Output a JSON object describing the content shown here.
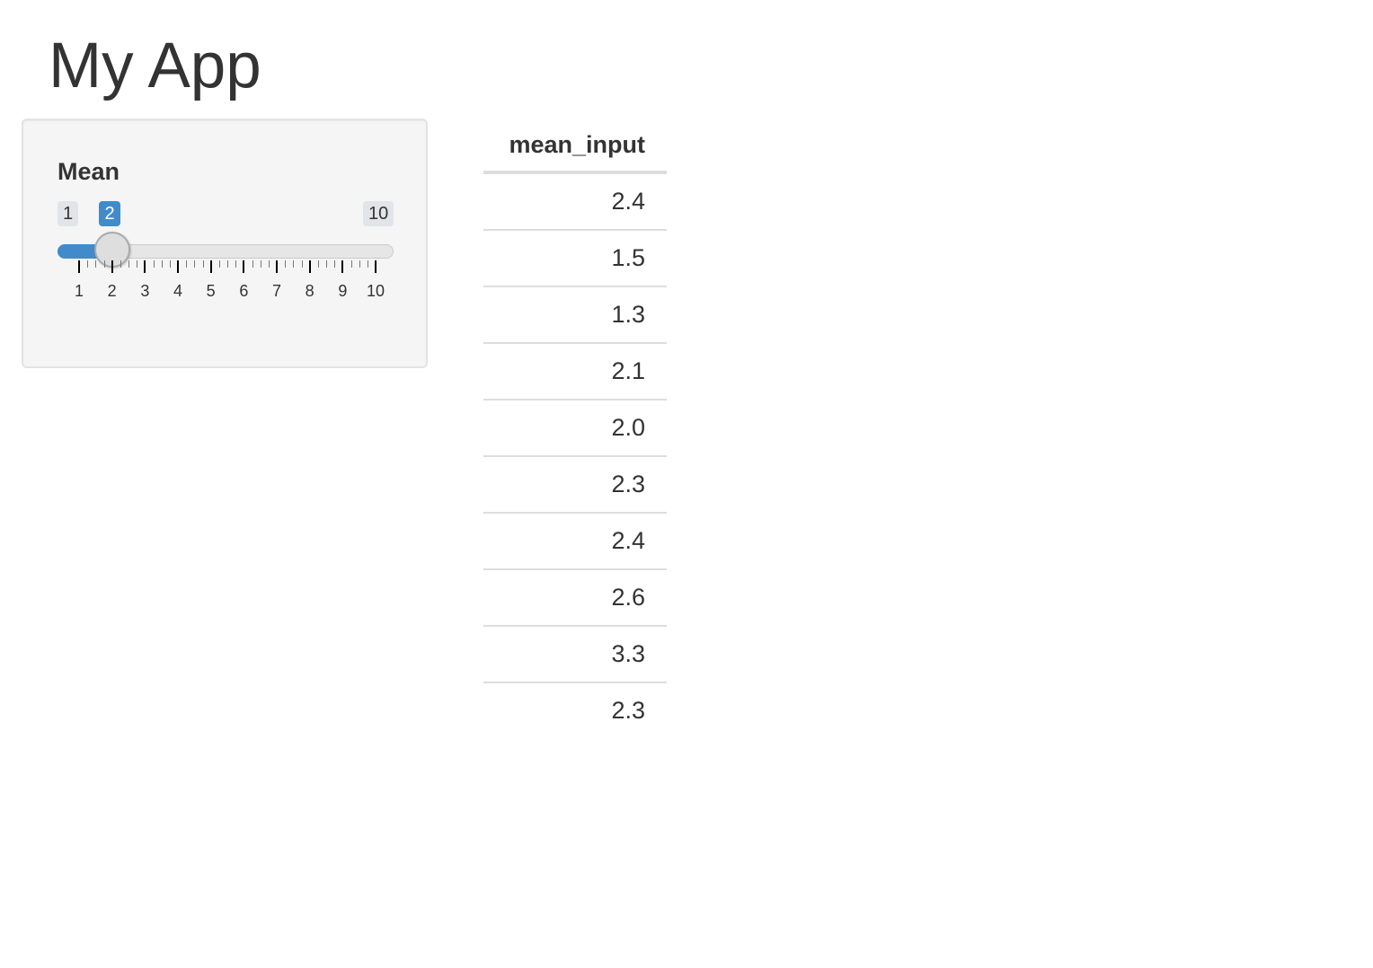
{
  "app": {
    "title": "My App"
  },
  "slider": {
    "label": "Mean",
    "min": 1,
    "max": 10,
    "value": 2,
    "min_label": "1",
    "max_label": "10",
    "value_label": "2",
    "tick_labels": [
      "1",
      "2",
      "3",
      "4",
      "5",
      "6",
      "7",
      "8",
      "9",
      "10"
    ],
    "accent_color": "#428bca"
  },
  "table": {
    "columns": [
      "mean_input"
    ],
    "rows": [
      "2.4",
      "1.5",
      "1.3",
      "2.1",
      "2.0",
      "2.3",
      "2.4",
      "2.6",
      "3.3",
      "2.3"
    ]
  }
}
